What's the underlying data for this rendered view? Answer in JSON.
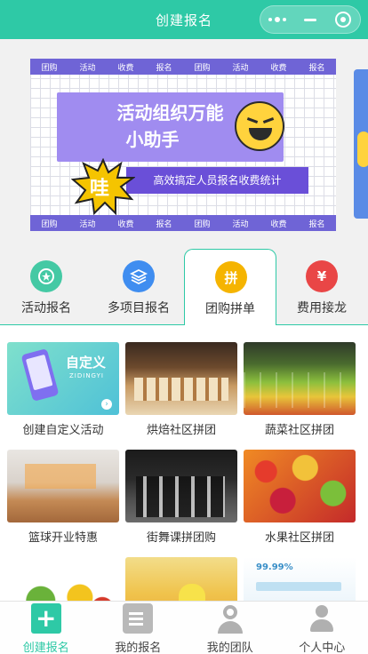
{
  "header": {
    "title": "创建报名"
  },
  "banner": {
    "strip_words": [
      "团购",
      "活动",
      "收费",
      "报名",
      "团购",
      "活动",
      "收费",
      "报名"
    ],
    "headline_line1": "活动组织万能",
    "headline_line2": "小助手",
    "burst_text": "哇",
    "subline": "高效搞定人员报名收费统计"
  },
  "categories": [
    {
      "label": "活动报名",
      "icon": "activity-badge-icon",
      "color": "#44c9a4"
    },
    {
      "label": "多项目报名",
      "icon": "layers-icon",
      "color": "#3f8df0"
    },
    {
      "label": "团购拼单",
      "icon": "group-buy-icon",
      "glyph": "拼",
      "color": "#f5b400"
    },
    {
      "label": "费用接龙",
      "icon": "fee-relay-icon",
      "glyph": "¥",
      "color": "#e94646"
    }
  ],
  "grid": {
    "items": [
      {
        "caption": "创建自定义活动",
        "img_title": "自定义",
        "img_sub": "ZIDINGYI"
      },
      {
        "caption": "烘焙社区拼团"
      },
      {
        "caption": "蔬菜社区拼团"
      },
      {
        "caption": "篮球开业特惠"
      },
      {
        "caption": "街舞课拼团购"
      },
      {
        "caption": "水果社区拼团"
      },
      {
        "caption": ""
      },
      {
        "caption": ""
      },
      {
        "caption": "",
        "img_text": "99.99%"
      }
    ]
  },
  "bottom_nav": {
    "items": [
      {
        "label": "创建报名",
        "icon": "plus-icon"
      },
      {
        "label": "我的报名",
        "icon": "edit-doc-icon"
      },
      {
        "label": "我的团队",
        "icon": "team-icon"
      },
      {
        "label": "个人中心",
        "icon": "user-icon"
      }
    ]
  },
  "colors": {
    "primary": "#2ec9a6",
    "banner_purple": "#6f64d6"
  }
}
